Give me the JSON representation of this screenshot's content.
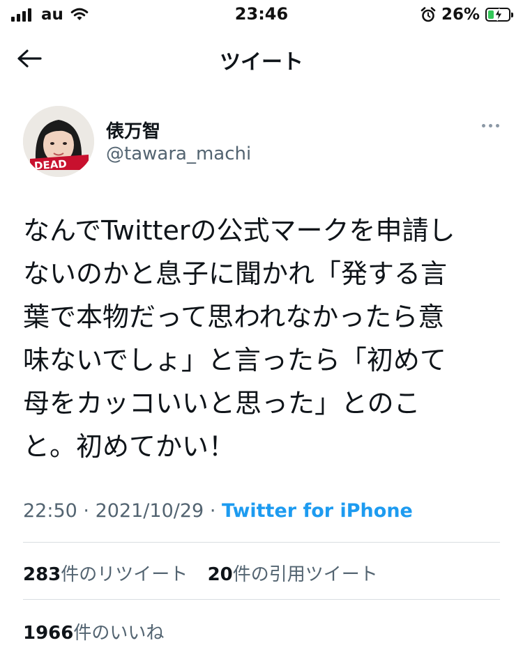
{
  "status_bar": {
    "carrier": "au",
    "time": "23:46",
    "battery_percent": "26%",
    "battery_level": 0.26
  },
  "nav": {
    "title": "ツイート",
    "back_icon": "arrow-left-icon"
  },
  "tweet": {
    "author_name": "俵万智",
    "author_handle": "@tawara_machi",
    "avatar_badge_text": "DEAD",
    "text_lines": [
      "なんでTwitterの公式マークを申請し",
      "ないのかと息子に聞かれ「発する言",
      "葉で本物だって思われなかったら意",
      "味ないでしょ」と言ったら「初めて",
      "母をカッコいいと思った」とのこ",
      "と。初めてかい！"
    ],
    "time": "22:50",
    "separator": "·",
    "date": "2021/10/29",
    "source": "Twitter for iPhone",
    "retweets": {
      "count": "283",
      "label": "件のリツイート"
    },
    "quotes": {
      "count": "20",
      "label": "件の引用ツイート"
    },
    "likes": {
      "count": "1966",
      "label": "件のいいね"
    }
  },
  "colors": {
    "link_blue": "#1d9bf0",
    "secondary_text": "#536471",
    "primary_text": "#0f1419",
    "battery_green": "#34c759"
  }
}
